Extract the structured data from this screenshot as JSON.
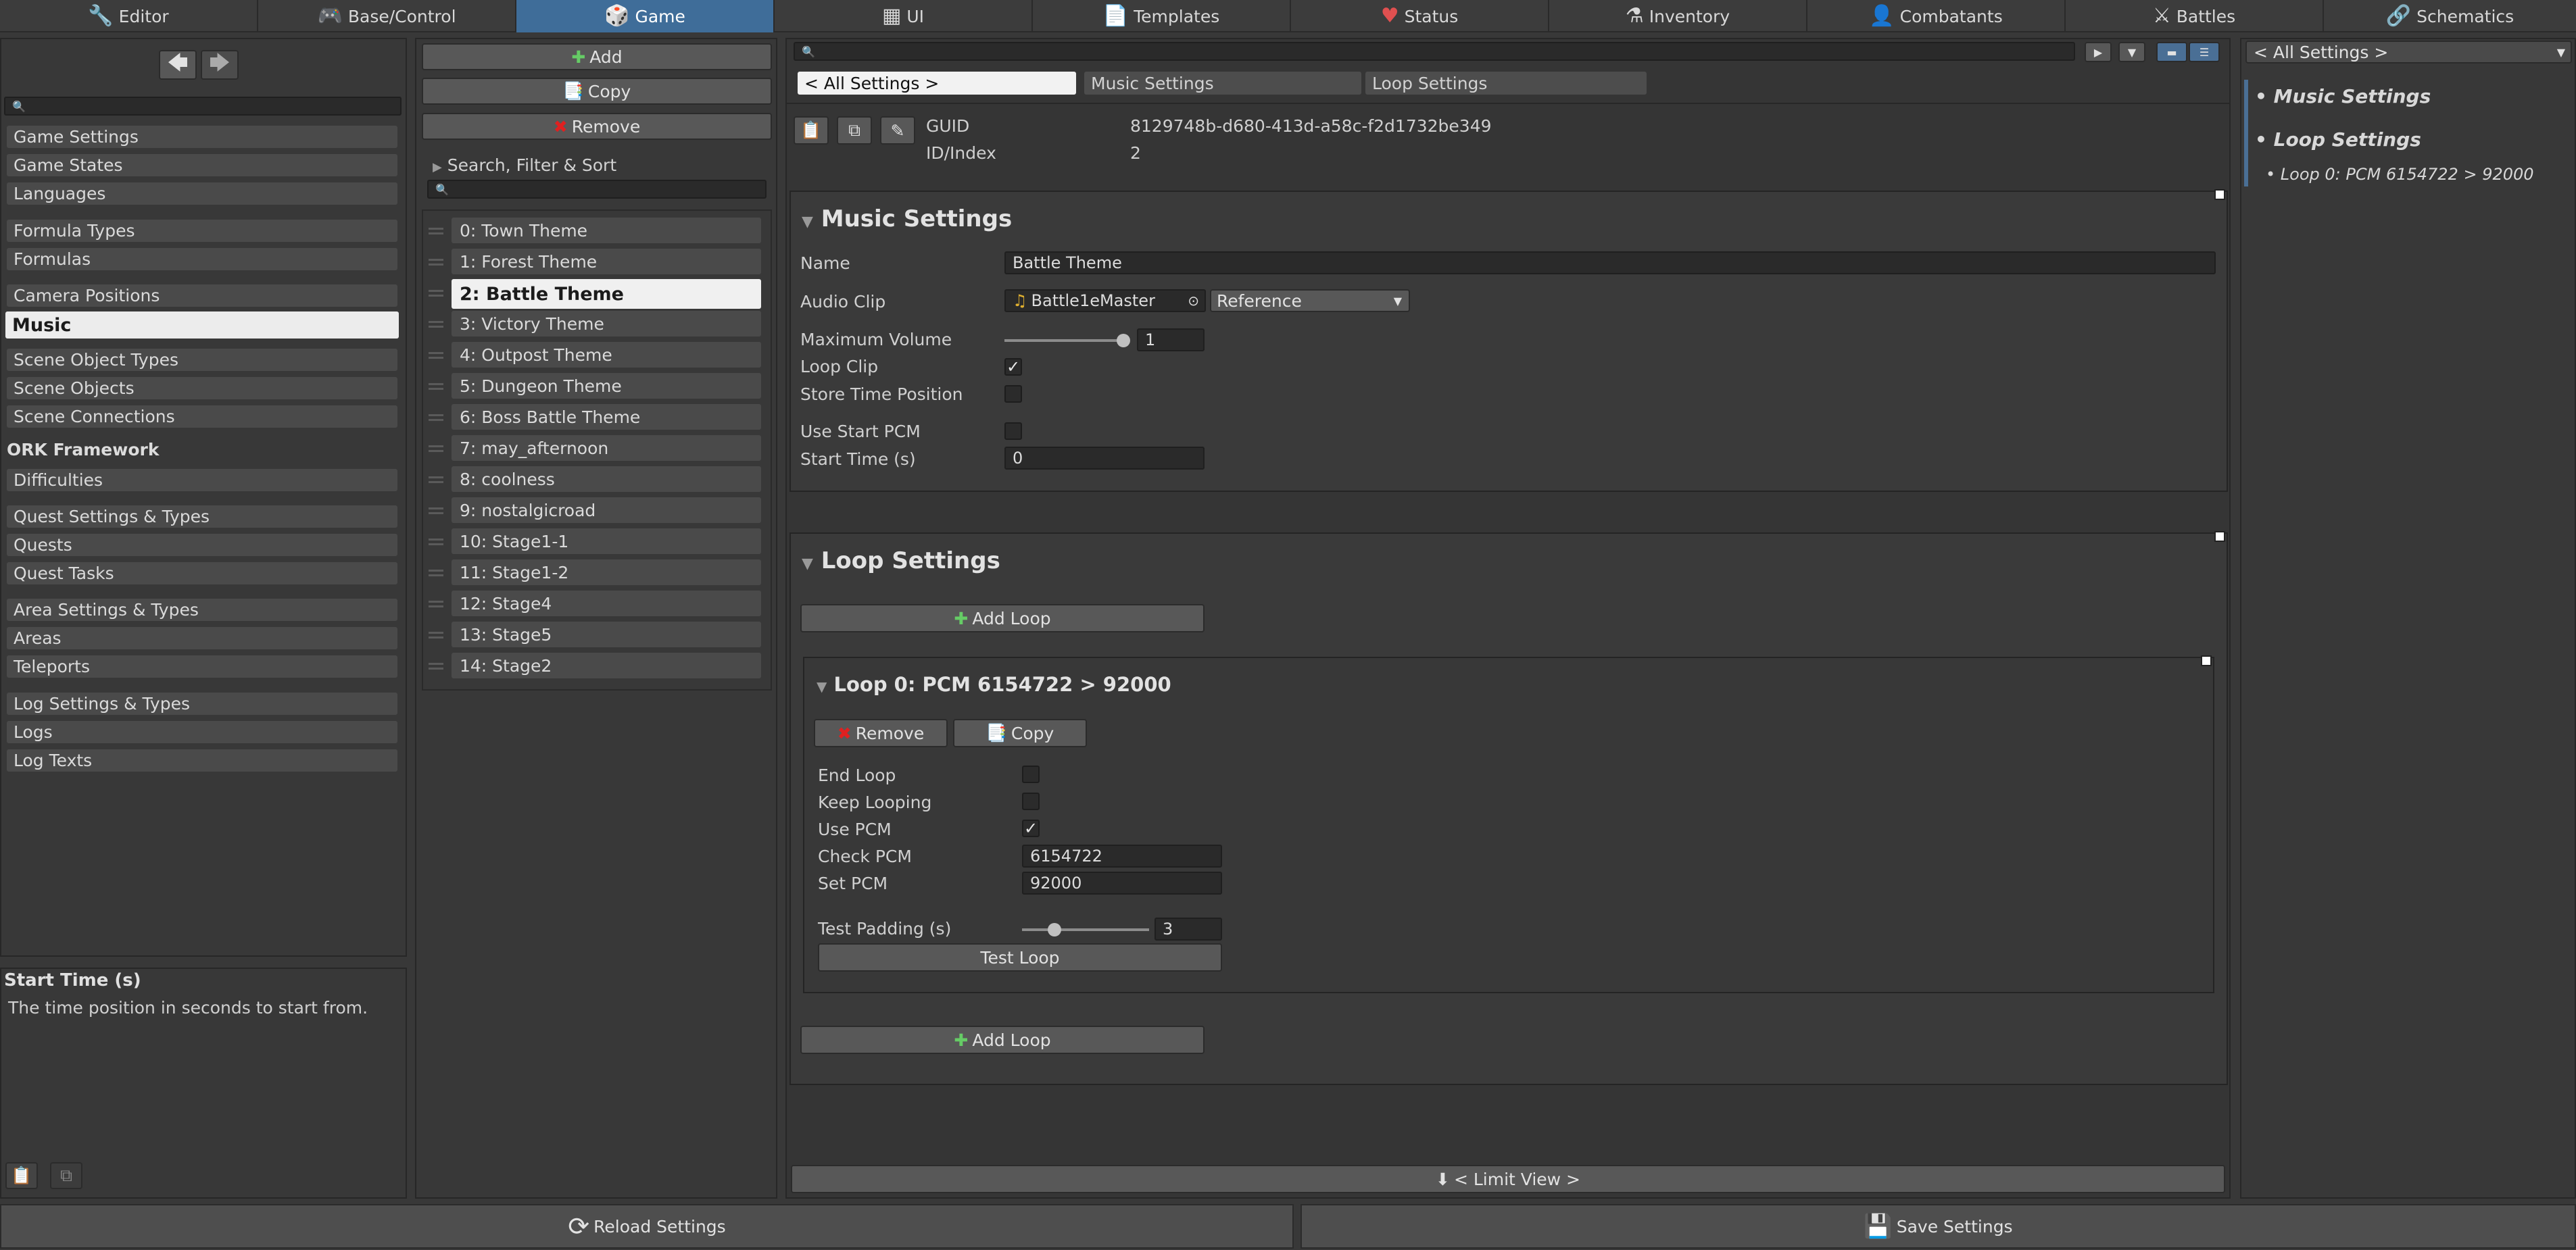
{
  "top_tabs": [
    {
      "label": "Editor",
      "icon": "wrench-icon",
      "glyph": "🔧"
    },
    {
      "label": "Base/Control",
      "icon": "gamepad-icon",
      "glyph": "🎮"
    },
    {
      "label": "Game",
      "icon": "dice-icon",
      "glyph": "🎲"
    },
    {
      "label": "UI",
      "icon": "ui-window-icon",
      "glyph": "▦"
    },
    {
      "label": "Templates",
      "icon": "document-icon",
      "glyph": "📄"
    },
    {
      "label": "Status",
      "icon": "heart-icon",
      "glyph": "♥"
    },
    {
      "label": "Inventory",
      "icon": "potion-icon",
      "glyph": "⚗"
    },
    {
      "label": "Combatants",
      "icon": "combatant-icon",
      "glyph": "👤"
    },
    {
      "label": "Battles",
      "icon": "swords-icon",
      "glyph": "⚔"
    },
    {
      "label": "Schematics",
      "icon": "schematic-icon",
      "glyph": "🔗"
    }
  ],
  "nav": {
    "items": [
      "Game Settings",
      "Game States",
      "Languages",
      "Formula Types",
      "Formulas",
      "Camera Positions",
      "Music",
      "Scene Object Types",
      "Scene Objects",
      "Scene Connections",
      "ORK Framework",
      "Difficulties",
      "Quest Settings & Types",
      "Quests",
      "Quest Tasks",
      "Area Settings & Types",
      "Areas",
      "Teleports",
      "Log Settings & Types",
      "Logs",
      "Log Texts"
    ],
    "help_title": "Start Time (s)",
    "help_text": "The time position in seconds to start from."
  },
  "list_toolbar": {
    "add": "Add",
    "copy": "Copy",
    "remove": "Remove",
    "search_filter": "Search, Filter & Sort"
  },
  "list_items": [
    "0: Town Theme",
    "1: Forest Theme",
    "2: Battle Theme",
    "3: Victory Theme",
    "4: Outpost Theme",
    "5: Dungeon Theme",
    "6: Boss Battle Theme",
    "7: may_afternoon",
    "8: coolness",
    "9: nostalgicroad",
    "10: Stage1-1",
    "11: Stage1-2",
    "12: Stage4",
    "13: Stage5",
    "14: Stage2"
  ],
  "breadcrumbs": [
    "< All Settings >",
    "Music Settings",
    "Loop Settings"
  ],
  "meta": {
    "guid_label": "GUID",
    "guid_value": "8129748b-d680-413d-a58c-f2d1732be349",
    "index_label": "ID/Index",
    "index_value": "2"
  },
  "music_settings": {
    "title": "Music Settings",
    "name_label": "Name",
    "name_value": "Battle Theme",
    "clip_label": "Audio Clip",
    "clip_value": "Battle1eMaster",
    "clip_mode": "Reference",
    "volume_label": "Maximum Volume",
    "volume_value": "1",
    "volume_level": 1.0,
    "loop_clip_label": "Loop Clip",
    "loop_clip_checked": true,
    "store_time_label": "Store Time Position",
    "store_time_checked": false,
    "use_start_pcm_label": "Use Start PCM",
    "use_start_pcm_checked": false,
    "start_time_label": "Start Time (s)",
    "start_time_value": "0"
  },
  "loop_settings": {
    "title": "Loop Settings",
    "add_loop": "Add Loop",
    "loop_title": "Loop 0: PCM 6154722 > 92000",
    "remove": "Remove",
    "copy": "Copy",
    "end_loop_label": "End Loop",
    "keep_looping_label": "Keep Looping",
    "use_pcm_label": "Use PCM",
    "use_pcm_checked": true,
    "check_pcm_label": "Check PCM",
    "check_pcm_value": "6154722",
    "set_pcm_label": "Set PCM",
    "set_pcm_value": "92000",
    "test_padding_label": "Test Padding (s)",
    "test_padding_value": "3",
    "test_loop": "Test Loop"
  },
  "limit_view": "< Limit View >",
  "footer": {
    "reload": "Reload Settings",
    "save": "Save Settings"
  },
  "tree": {
    "dropdown": "< All Settings >",
    "items": [
      "Music Settings",
      "Loop Settings"
    ],
    "sub_item": "• Loop 0: PCM 6154722 > 92000"
  },
  "colors": {
    "active_tab": "#3f6d99",
    "background": "#383838",
    "remove_icon": "#e02020"
  }
}
